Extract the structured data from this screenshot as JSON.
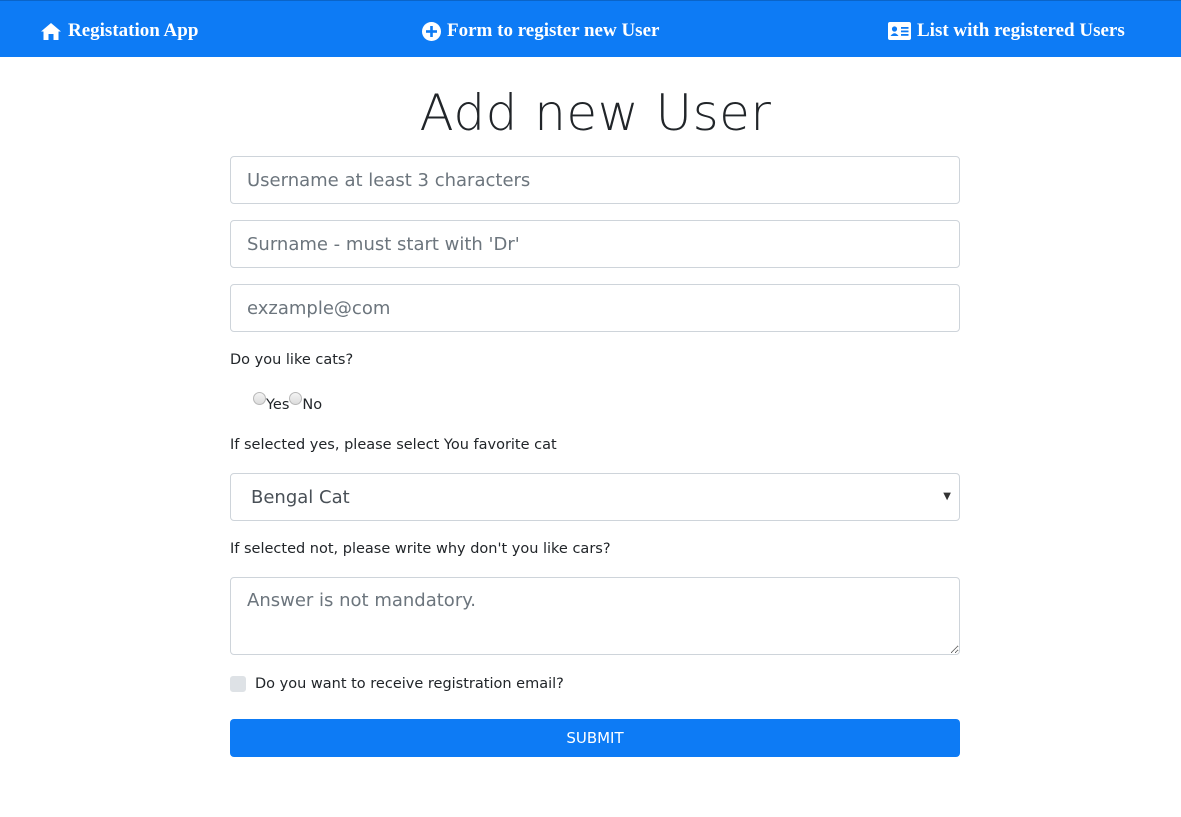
{
  "nav": {
    "brand_label": "Registation App",
    "form_label": "Form to register new User",
    "list_label": "List with registered Users",
    "brand_icon": "home-icon",
    "form_icon": "plus-circle-icon",
    "list_icon": "id-card-icon"
  },
  "form": {
    "title": "Add new User",
    "username_placeholder": "Username at least 3 characters",
    "surname_placeholder": "Surname - must start with 'Dr'",
    "email_placeholder": "exzample@com",
    "cats_question": "Do you like cats?",
    "radio_yes": "Yes",
    "radio_no": "No",
    "favorite_label": "If selected yes, please select You favorite cat",
    "favorite_selected": "Bengal Cat",
    "why_label": "If selected not, please write why don't you like cars?",
    "why_placeholder": "Answer is not mandatory.",
    "email_checkbox_label": "Do you want to receive registration email?",
    "submit_label": "SUBMIT"
  },
  "colors": {
    "primary": "#0d7bf5",
    "border": "#ced4da",
    "placeholder": "#6c757d"
  }
}
